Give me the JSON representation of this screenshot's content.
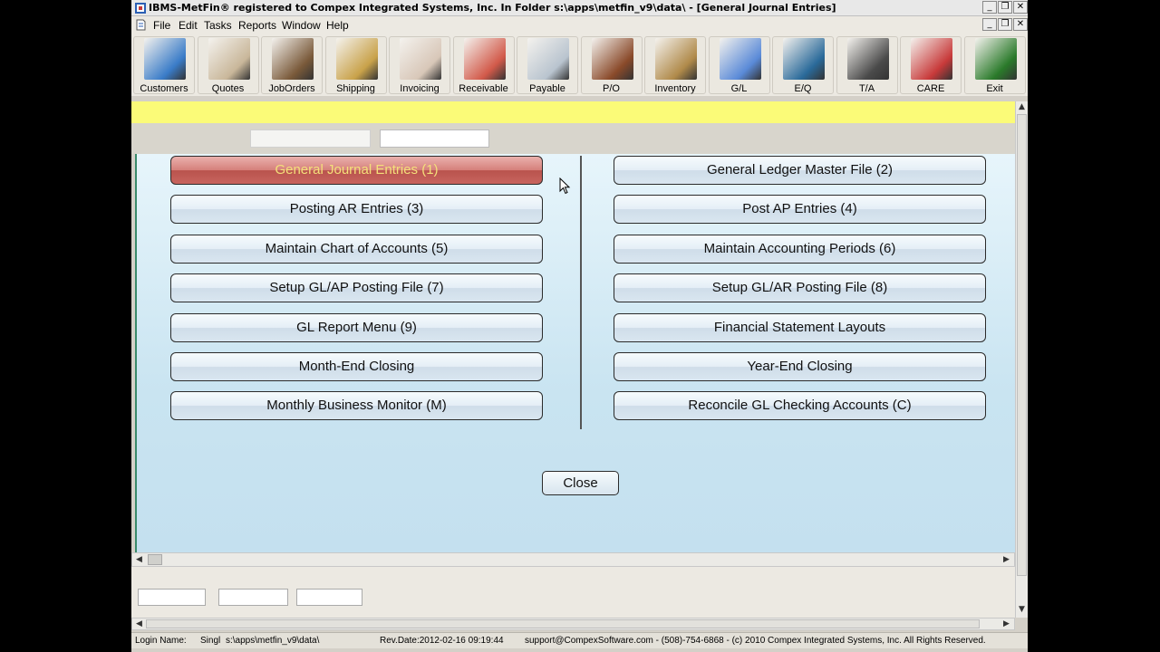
{
  "window": {
    "title": "IBMS-MetFin® registered to Compex Integrated Systems, Inc. In Folder s:\\apps\\metfin_v9\\data\\ - [General Journal Entries]",
    "controls": [
      "_",
      "❐",
      "✕"
    ]
  },
  "menu": [
    "File",
    "Edit",
    "Tasks",
    "Reports",
    "Window",
    "Help"
  ],
  "toolbar": [
    {
      "label": "Customers",
      "icon": "handshake-icon",
      "color": "#3a7cc8"
    },
    {
      "label": "Quotes",
      "icon": "calculator-icon",
      "color": "#c9b79a"
    },
    {
      "label": "JobOrders",
      "icon": "worker-icon",
      "color": "#7a5a3a"
    },
    {
      "label": "Shipping",
      "icon": "package-icon",
      "color": "#c9a24a"
    },
    {
      "label": "Invoicing",
      "icon": "invoice-icon",
      "color": "#d8c7b8"
    },
    {
      "label": "Receivable",
      "icon": "paid-stamp-icon",
      "color": "#d25a4a"
    },
    {
      "label": "Payable",
      "icon": "signing-pen-icon",
      "color": "#b9c4cf"
    },
    {
      "label": "P/O",
      "icon": "warehouse-worker-icon",
      "color": "#8a4a2a"
    },
    {
      "label": "Inventory",
      "icon": "warehouse-shelves-icon",
      "color": "#b08a4a"
    },
    {
      "label": "G/L",
      "icon": "ledger-icon",
      "color": "#5a8ad8"
    },
    {
      "label": "E/Q",
      "icon": "machine-icon",
      "color": "#2a6a9a"
    },
    {
      "label": "T/A",
      "icon": "time-clock-icon",
      "color": "#4a4a4a"
    },
    {
      "label": "CARE",
      "icon": "clipboard-icon",
      "color": "#c83a3a"
    },
    {
      "label": "Exit",
      "icon": "exit-sign-icon",
      "color": "#2a7a2a"
    }
  ],
  "buttons_left": [
    "General Journal Entries (1)",
    "Posting AR Entries (3)",
    "Maintain Chart of Accounts (5)",
    "Setup GL/AP Posting File (7)",
    "GL Report Menu (9)",
    "Month-End Closing",
    "Monthly Business Monitor (M)"
  ],
  "buttons_right": [
    "General Ledger Master File (2)",
    "Post AP Entries (4)",
    "Maintain Accounting Periods (6)",
    "Setup GL/AR Posting File (8)",
    "Financial Statement Layouts",
    "Year-End Closing",
    "Reconcile GL Checking Accounts (C)"
  ],
  "close_label": "Close",
  "status": {
    "login": "Login Name:",
    "user": "Singl",
    "folder": "s:\\apps\\metfin_v9\\data\\",
    "revdate": "Rev.Date:2012-02-16 09:19:44",
    "support": "support@CompexSoftware.com - (508)-754-6868 - (c) 2010 Compex Integrated Systems, Inc. All Rights Reserved."
  },
  "colors": {
    "yellow_strip": "#fbfb78",
    "active_button": "#c7645e",
    "active_text": "#f4e07a"
  }
}
